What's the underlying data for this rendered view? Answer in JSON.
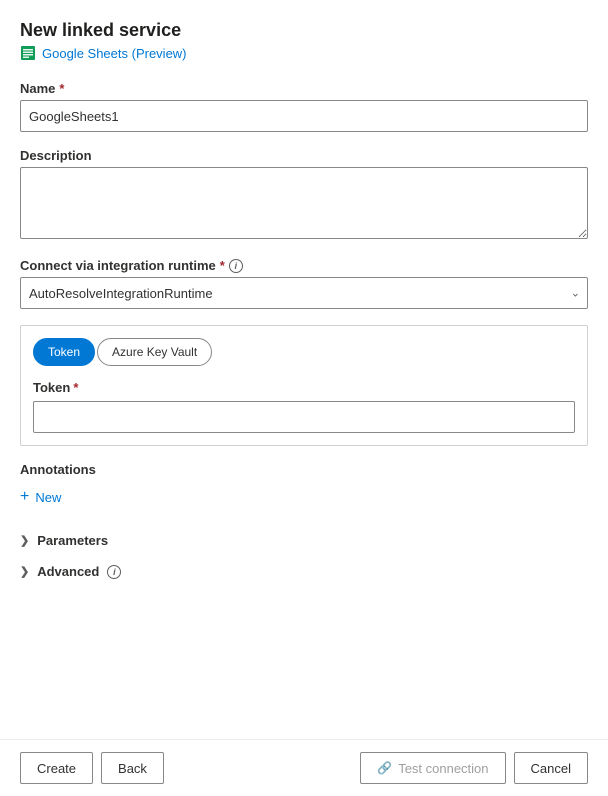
{
  "header": {
    "title": "New linked service",
    "subtitle": "Google Sheets (Preview)"
  },
  "form": {
    "name_label": "Name",
    "name_value": "GoogleSheets1",
    "description_label": "Description",
    "description_placeholder": "",
    "runtime_label": "Connect via integration runtime",
    "runtime_value": "AutoResolveIntegrationRuntime",
    "auth_tabs": [
      {
        "label": "Token",
        "active": true
      },
      {
        "label": "Azure Key Vault",
        "active": false
      }
    ],
    "token_label": "Token",
    "token_placeholder": ""
  },
  "annotations": {
    "label": "Annotations",
    "add_new_label": "New"
  },
  "parameters": {
    "label": "Parameters"
  },
  "advanced": {
    "label": "Advanced"
  },
  "footer": {
    "create_label": "Create",
    "back_label": "Back",
    "test_label": "Test connection",
    "cancel_label": "Cancel"
  },
  "icons": {
    "sheets": "🟩",
    "info": "i",
    "chevron_down": "⌄",
    "chevron_right": "›",
    "plus": "+",
    "link": "🔗"
  }
}
